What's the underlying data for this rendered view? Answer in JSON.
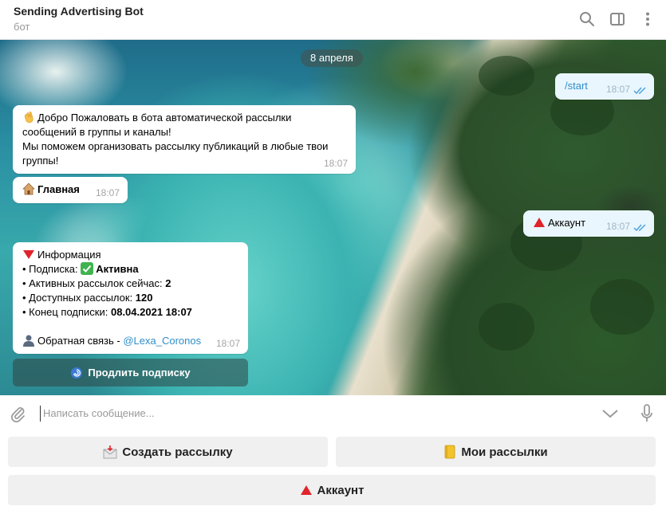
{
  "header": {
    "title": "Sending Advertising Bot",
    "subtitle": "бот",
    "icons": [
      "search-icon",
      "sidebar-toggle-icon",
      "more-vertical-icon"
    ]
  },
  "chat": {
    "date": "8 апреля",
    "messages": [
      {
        "type": "outgoing",
        "text": "/start",
        "time": "18:07",
        "read": true
      },
      {
        "type": "incoming",
        "emoji": "waving-hand",
        "line1": "Добро Пожаловать в бота автоматической рассылки",
        "line2": "сообщений в группы и каналы!",
        "line3": "Мы поможем организовать рассылку публикаций в любые твои",
        "line4": "группы!",
        "time": "18:07"
      },
      {
        "type": "incoming",
        "emoji": "house",
        "text": "Главная",
        "time": "18:07"
      },
      {
        "type": "outgoing",
        "emoji": "red-triangle",
        "text": "Аккаунт",
        "time": "18:07",
        "read": true
      },
      {
        "type": "incoming",
        "info_title": "Информация",
        "sub_label": "• Подписка: ",
        "sub_value": "Активна",
        "active_label": "• Активных рассылок сейчас: ",
        "active_value": "2",
        "avail_label": "• Доступных рассылок: ",
        "avail_value": "120",
        "end_label": "• Конец подписки: ",
        "end_value": "08.04.2021 18:07",
        "feedback_label": "Обратная связь - ",
        "feedback_link": "@Lexa_Coronos",
        "time": "18:07"
      }
    ],
    "inline_button": "Продлить подписку"
  },
  "input": {
    "placeholder": "Написать сообщение...",
    "icons": [
      "attach-icon",
      "chevron-down-icon",
      "microphone-icon"
    ]
  },
  "keyboard": {
    "create_label": "Создать рассылку",
    "my_label": "Мои рассылки",
    "account_label": "Аккаунт"
  },
  "colors": {
    "accent": "#2f8ecb",
    "read_ticks": "#4fa3e0",
    "outgoing_bubble": "#e9f5ff",
    "keyboard_button": "#f0f0f0"
  }
}
